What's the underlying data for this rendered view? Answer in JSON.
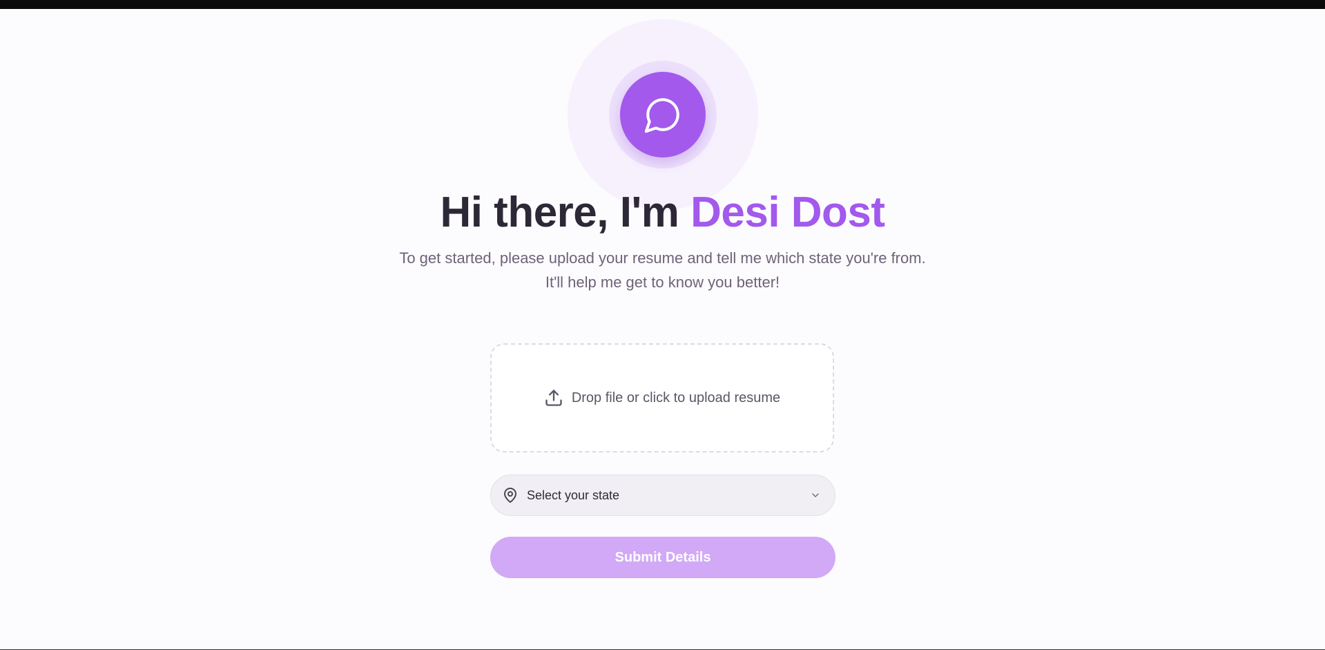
{
  "hero": {
    "avatar_icon": "message-circle-icon",
    "greeting": "Hi there, I'm",
    "brand_name": "Desi Dost",
    "subtitle_line1": "To get started, please upload your resume and tell me which state you're from.",
    "subtitle_line2": "It'll help me get to know you better!"
  },
  "upload": {
    "icon": "upload-icon",
    "label": "Drop file or click to upload resume"
  },
  "state_select": {
    "icon": "map-pin-icon",
    "placeholder": "Select your state",
    "chevron_icon": "chevron-down-icon"
  },
  "submit": {
    "label": "Submit Details"
  },
  "colors": {
    "accent": "#a259ec",
    "accent_disabled": "#d1a9f6",
    "heading": "#2d2836",
    "body_text": "#6d6378",
    "background": "#fcfbfe"
  }
}
